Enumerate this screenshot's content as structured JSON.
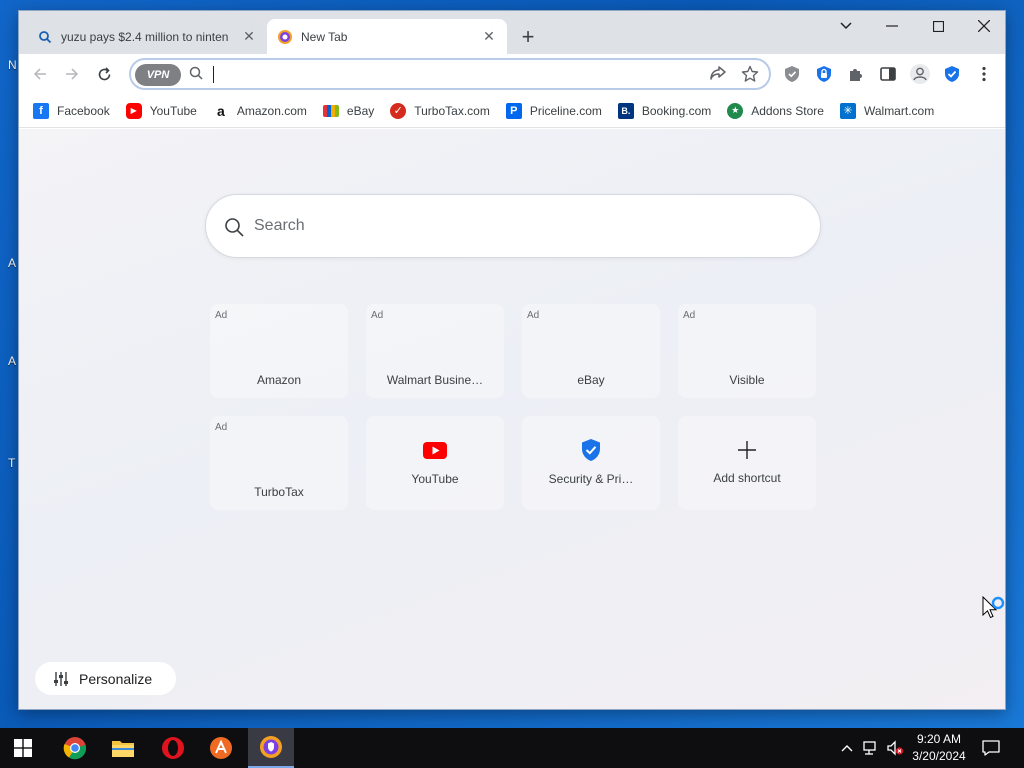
{
  "desktop": {
    "labels": [
      "N",
      "A",
      "A",
      "T"
    ]
  },
  "window": {
    "tabs": [
      {
        "title": "yuzu pays $2.4 million to ninten",
        "icon": "search-icon"
      },
      {
        "title": "New Tab",
        "icon": "browser-logo-icon"
      }
    ],
    "new_tab_label": "+"
  },
  "toolbar": {
    "vpn_label": "VPN",
    "omnibox_value": "",
    "extensions": [
      "puzzle-shield-icon",
      "lock-shield-icon",
      "puzzle-icon",
      "sidebar-icon",
      "profile-icon",
      "shield-check-icon"
    ]
  },
  "bookmarks": [
    {
      "label": "Facebook",
      "icon": "facebook-icon",
      "color": "#1877f2",
      "glyph": "f"
    },
    {
      "label": "YouTube",
      "icon": "youtube-icon",
      "color": "#ff0000",
      "glyph": "▶"
    },
    {
      "label": "Amazon.com",
      "icon": "amazon-icon",
      "color": "#ffffff",
      "glyph": "a"
    },
    {
      "label": "eBay",
      "icon": "ebay-icon",
      "color": "#e53238",
      "glyph": ""
    },
    {
      "label": "TurboTax.com",
      "icon": "turbotax-icon",
      "color": "#d52b1e",
      "glyph": "✓"
    },
    {
      "label": "Priceline.com",
      "icon": "priceline-icon",
      "color": "#0068ef",
      "glyph": "P"
    },
    {
      "label": "Booking.com",
      "icon": "booking-icon",
      "color": "#003580",
      "glyph": "B."
    },
    {
      "label": "Addons Store",
      "icon": "addons-store-icon",
      "color": "#1f8a4c",
      "glyph": "★"
    },
    {
      "label": "Walmart.com",
      "icon": "walmart-icon",
      "color": "#0071ce",
      "glyph": "✳"
    }
  ],
  "ntp": {
    "search_placeholder": "Search",
    "personalize_label": "Personalize",
    "shortcuts": [
      {
        "label": "Amazon",
        "ad": "Ad"
      },
      {
        "label": "Walmart Busine…",
        "ad": "Ad"
      },
      {
        "label": "eBay",
        "ad": "Ad"
      },
      {
        "label": "Visible",
        "ad": "Ad"
      },
      {
        "label": "TurboTax",
        "ad": "Ad"
      },
      {
        "label": "YouTube",
        "ad": "",
        "icon": "youtube-icon"
      },
      {
        "label": "Security & Pri…",
        "ad": "",
        "icon": "shield-check-icon"
      },
      {
        "label": "Add shortcut",
        "ad": "",
        "icon": "plus-icon"
      }
    ]
  },
  "taskbar": {
    "apps": [
      "chrome-icon",
      "file-explorer-icon",
      "opera-icon",
      "app-icon",
      "browser-icon"
    ],
    "active_app": "browser-icon",
    "time": "9:20 AM",
    "date": "3/20/2024"
  },
  "colors": {
    "desktop_blue": "#1166c9",
    "brand_blue": "#1a73e8",
    "youtube_red": "#ff0000"
  }
}
